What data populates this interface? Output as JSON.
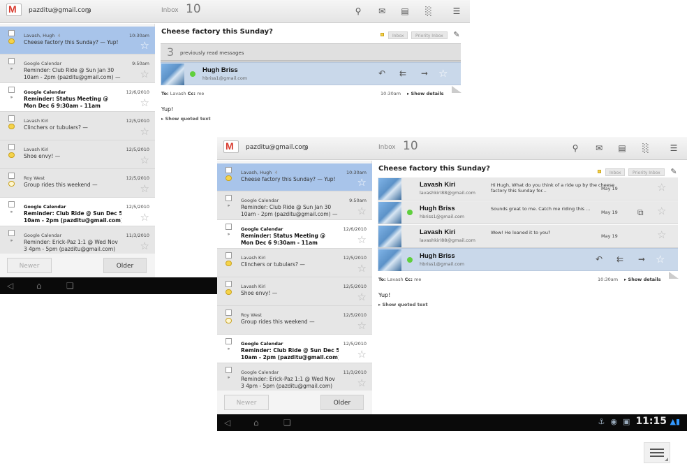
{
  "app": {
    "account": "pazditu@gmail.com",
    "inbox_label": "Inbox",
    "inbox_count": "10"
  },
  "toolbar": {
    "search_icon": "search-icon",
    "compose_icon": "compose-icon",
    "archive_icon": "archive-icon",
    "delete_icon": "trash-icon",
    "menu_icon": "menu-icon"
  },
  "list": {
    "rows": [
      {
        "sender": "Lavash, Hugh",
        "count": "4",
        "subject": "Cheese factory this Sunday? — Yup!",
        "subject2": "",
        "date": "10:30am",
        "state": "selected",
        "label": "dot"
      },
      {
        "sender": "Google Calendar",
        "count": "",
        "subject": "Reminder: Club Ride @ Sun Jan 30",
        "subject2": "10am - 2pm (pazditu@gmail.com) —",
        "date": "9:50am",
        "state": "read",
        "label": "»"
      },
      {
        "sender": "Google Calendar",
        "count": "",
        "subject": "Reminder: Status Meeting @",
        "subject2": "Mon Dec 6 9:30am - 11am",
        "date": "12/6/2010",
        "state": "unread",
        "label": "»"
      },
      {
        "sender": "Lavash Kiri",
        "count": "",
        "subject": "Clinchers or tubulars? —",
        "subject2": "",
        "date": "12/5/2010",
        "state": "read",
        "label": "dot"
      },
      {
        "sender": "Lavash Kiri",
        "count": "",
        "subject": "Shoe envy! —",
        "subject2": "",
        "date": "12/5/2010",
        "state": "read",
        "label": "dot"
      },
      {
        "sender": "Roy West",
        "count": "",
        "subject": "Group rides this weekend —",
        "subject2": "",
        "date": "12/5/2010",
        "state": "read",
        "label": "ring"
      },
      {
        "sender": "Google Calendar",
        "count": "",
        "subject": "Reminder: Club Ride @ Sun Dec 5",
        "subject2": "10am - 2pm (pazditu@gmail.com)",
        "date": "12/5/2010",
        "state": "unread",
        "label": "»"
      },
      {
        "sender": "Google Calendar",
        "count": "",
        "subject": "Reminder: Erick-Paz 1:1 @ Wed Nov",
        "subject2": "3 4pm - 5pm (pazditu@gmail.com)",
        "date": "11/3/2010",
        "state": "read",
        "label": "»"
      }
    ],
    "newer": "Newer",
    "older": "Older"
  },
  "conversation": {
    "title": "Cheese factory this Sunday?",
    "label_inbox": "Inbox",
    "label_priority": "Priority Inbox",
    "previously_read_count": "3",
    "previously_read_text": "previously read messages",
    "messages": [
      {
        "name": "Lavash Kiri",
        "email": "lavashkiri88@gmail.com",
        "snippet": "Hi Hugh, What do you think of a ride up by the cheese factory this Sunday for...",
        "date": "May 19",
        "online": false,
        "attachment": false
      },
      {
        "name": "Hugh Briss",
        "email": "hbriss1@gmail.com",
        "snippet": "Sounds great to me. Catch me riding this ...",
        "date": "May 19",
        "online": true,
        "attachment": true
      },
      {
        "name": "Lavash Kiri",
        "email": "lavashkiri88@gmail.com",
        "snippet": "Wow! He loaned it to you?",
        "date": "May 19",
        "online": false,
        "attachment": false
      }
    ],
    "open_message": {
      "name": "Hugh Briss",
      "email": "hbriss1@gmail.com",
      "to_label": "To:",
      "to": "Lavash",
      "cc_label": "Cc:",
      "cc": "me",
      "time": "10:30am",
      "show_details": "▸ Show details",
      "body": "Yup!",
      "show_quoted": "▸ Show quoted text"
    }
  },
  "system_bar": {
    "time": "11:15",
    "icons": [
      "usb-icon",
      "android-debug-icon",
      "notification-icon"
    ]
  }
}
